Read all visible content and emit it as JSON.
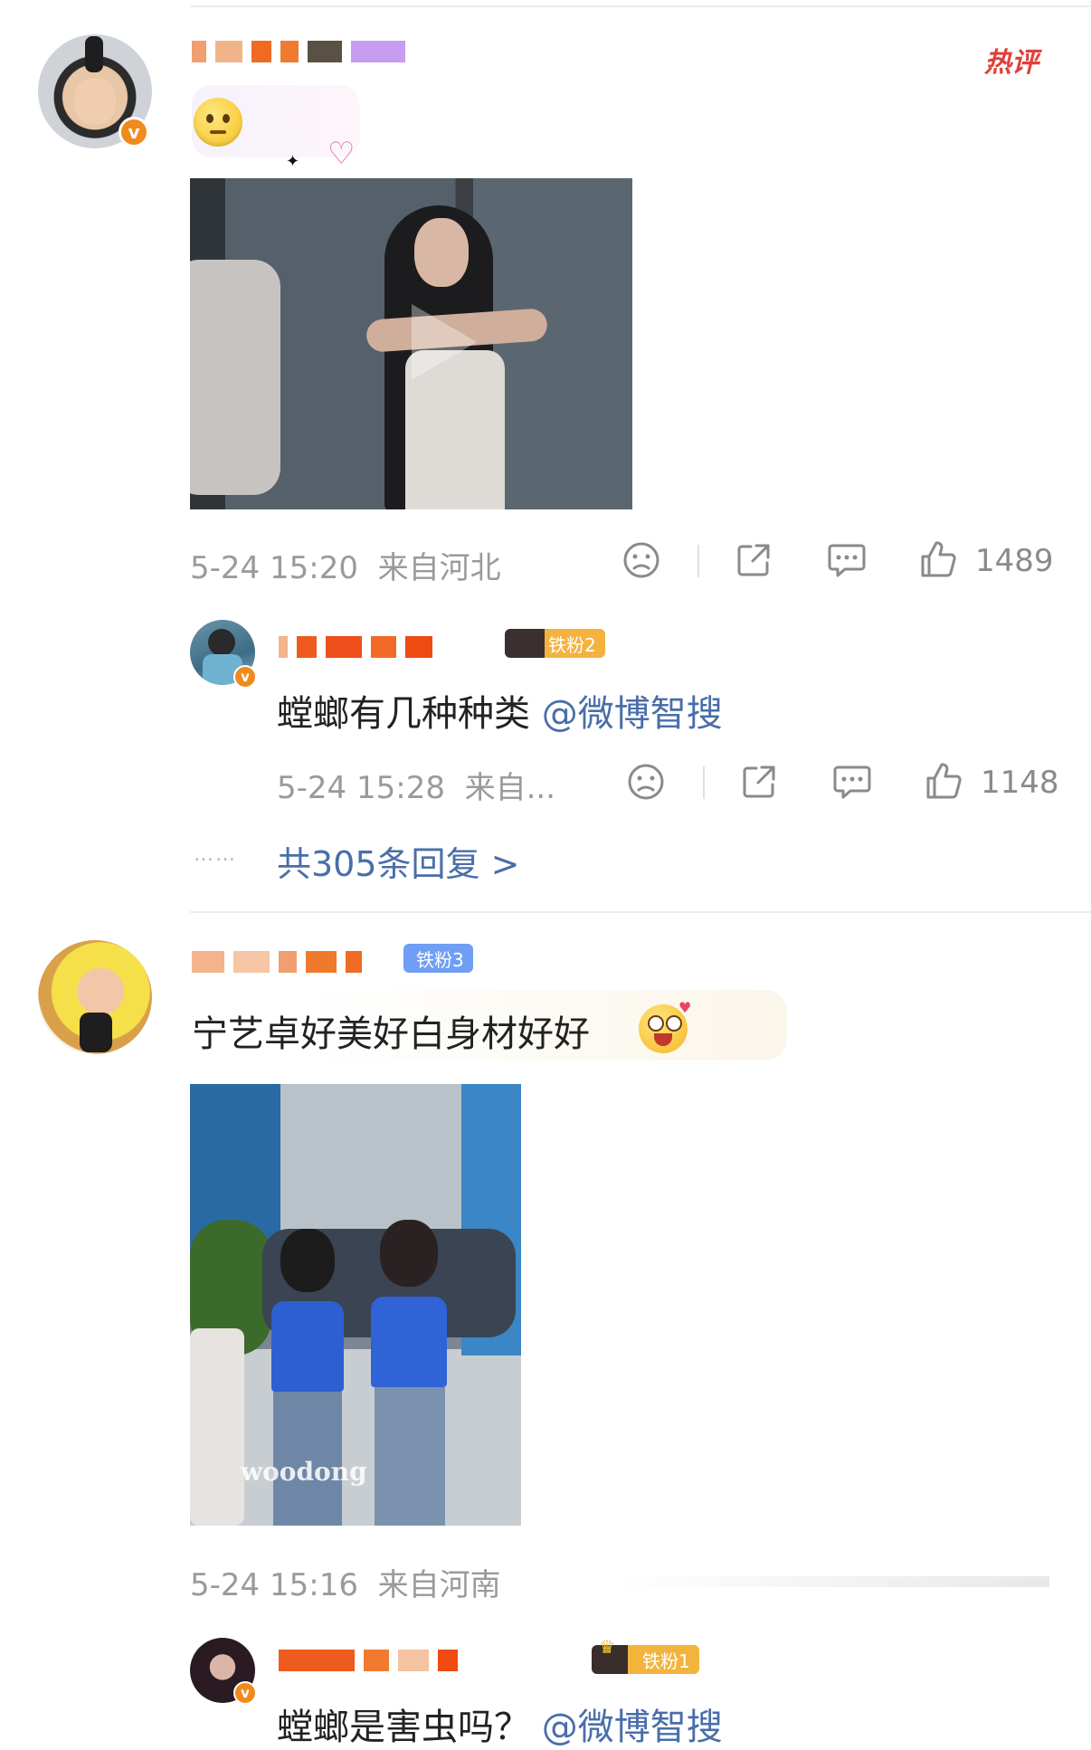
{
  "hot_tag": "热评",
  "comments": [
    {
      "time": "5-24 15:20",
      "location": "来自河北",
      "likes": "1489"
    },
    {
      "text": "宁艺卓好美好白身材好好",
      "time": "5-24 15:16",
      "location": "来自河南",
      "watermark": "woodong"
    }
  ],
  "replies": [
    {
      "fan_badge": "铁粉2",
      "text": "螳螂有几种种类",
      "mention": "@微博智搜",
      "time": "5-24 15:28",
      "location": "来自...",
      "likes": "1148"
    },
    {
      "fan_badge": "铁粉3"
    },
    {
      "fan_badge": "铁粉1",
      "text": "螳螂是害虫吗？",
      "mention": "@微博智搜"
    }
  ],
  "more_replies": {
    "dots": "……",
    "label": "共305条回复 >"
  },
  "colors": {
    "accent_orange": "#f08a1d",
    "mention_blue": "#496ea9",
    "hot_red": "#e0403a"
  }
}
